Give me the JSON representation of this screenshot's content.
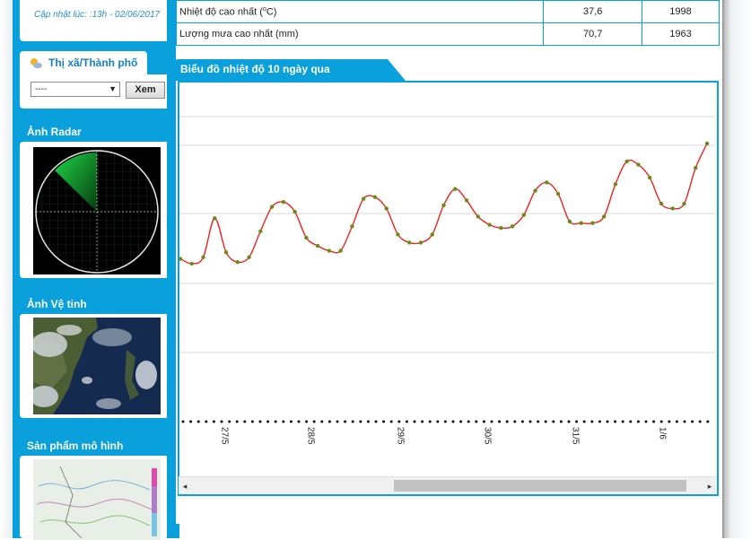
{
  "sidebar": {
    "update_text": "Cập nhật lúc: :13h - 02/06/2017",
    "city": {
      "title": "Thị xã/Thành phố",
      "selected": "----",
      "button": "Xem"
    },
    "radar_title": "Ảnh Radar",
    "satellite_title": "Ảnh Vệ tinh",
    "model_title": "Sản phẩm mô hình"
  },
  "records": [
    {
      "label": "Nhiệt độ cao nhất (°C)",
      "value": "37,6",
      "year": "1998"
    },
    {
      "label": "Lượng mưa cao nhất (mm)",
      "value": "70,7",
      "year": "1963"
    }
  ],
  "chart_tab_title": "Biểu đồ nhiệt độ 10 ngày qua",
  "colors": {
    "accent": "#0aa0dc",
    "line": "#e8251d",
    "point": "#6b8a1a"
  },
  "chart_data": {
    "type": "line",
    "title": "Biểu đồ nhiệt độ 10 ngày qua",
    "categories": [
      "27/5",
      "28/5",
      "29/5",
      "30/5",
      "31/5",
      "1/6"
    ],
    "grid": "horizontal",
    "series": [
      {
        "values": [
          26.5,
          26.2,
          26.6,
          29.0,
          26.9,
          26.3,
          26.6,
          28.2,
          29.7,
          30.0,
          29.4,
          27.8,
          27.3,
          27.0,
          27.0,
          28.5,
          30.2,
          30.3,
          29.6,
          28.0,
          27.5,
          27.5,
          28.0,
          29.8,
          30.8,
          30.1,
          29.1,
          28.6,
          28.4,
          28.5,
          29.2,
          30.7,
          31.2,
          30.5,
          28.8,
          28.7,
          28.7,
          29.1,
          31.1,
          32.5,
          32.3,
          31.5,
          29.9,
          29.6,
          29.9,
          32.1,
          33.6
        ]
      }
    ]
  },
  "scrollbar": {
    "left_arrow": "◂",
    "right_arrow": "▸"
  }
}
